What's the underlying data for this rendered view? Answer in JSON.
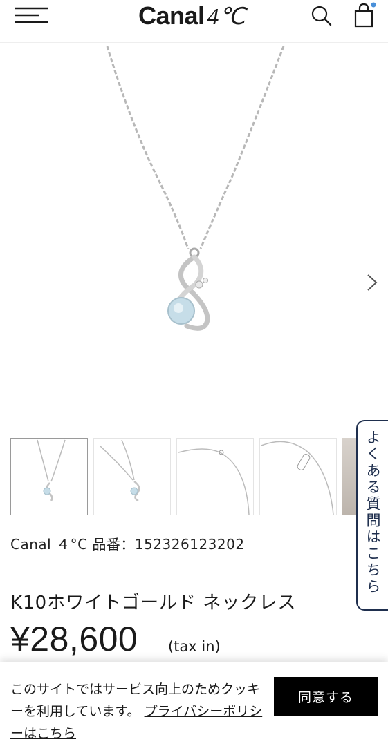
{
  "header": {
    "brand_text": "Canal",
    "brand_mark": "4℃",
    "menu_icon": "hamburger-icon",
    "search_icon": "search-icon",
    "cart_icon": "shopping-bag-icon",
    "cart_badge_color": "#4a90d9"
  },
  "gallery": {
    "next_icon": "chevron-right-icon",
    "thumbnails": [
      "thumb-1",
      "thumb-2",
      "thumb-3",
      "thumb-4",
      "thumb-5"
    ]
  },
  "faq": {
    "label": "よくある質問はこちら"
  },
  "product": {
    "code": "Canal ４°C 品番：152326123202",
    "name": "K10ホワイトゴールド ネックレス",
    "price": "¥28,600",
    "tax": "(tax in)"
  },
  "cookie": {
    "text": "このサイトではサービス向上のためクッキーを利用しています。",
    "link": "プライバシーポリシーはこちら",
    "agree_label": "同意する"
  },
  "colors": {
    "accent": "#1f2f4e",
    "button": "#000000"
  }
}
